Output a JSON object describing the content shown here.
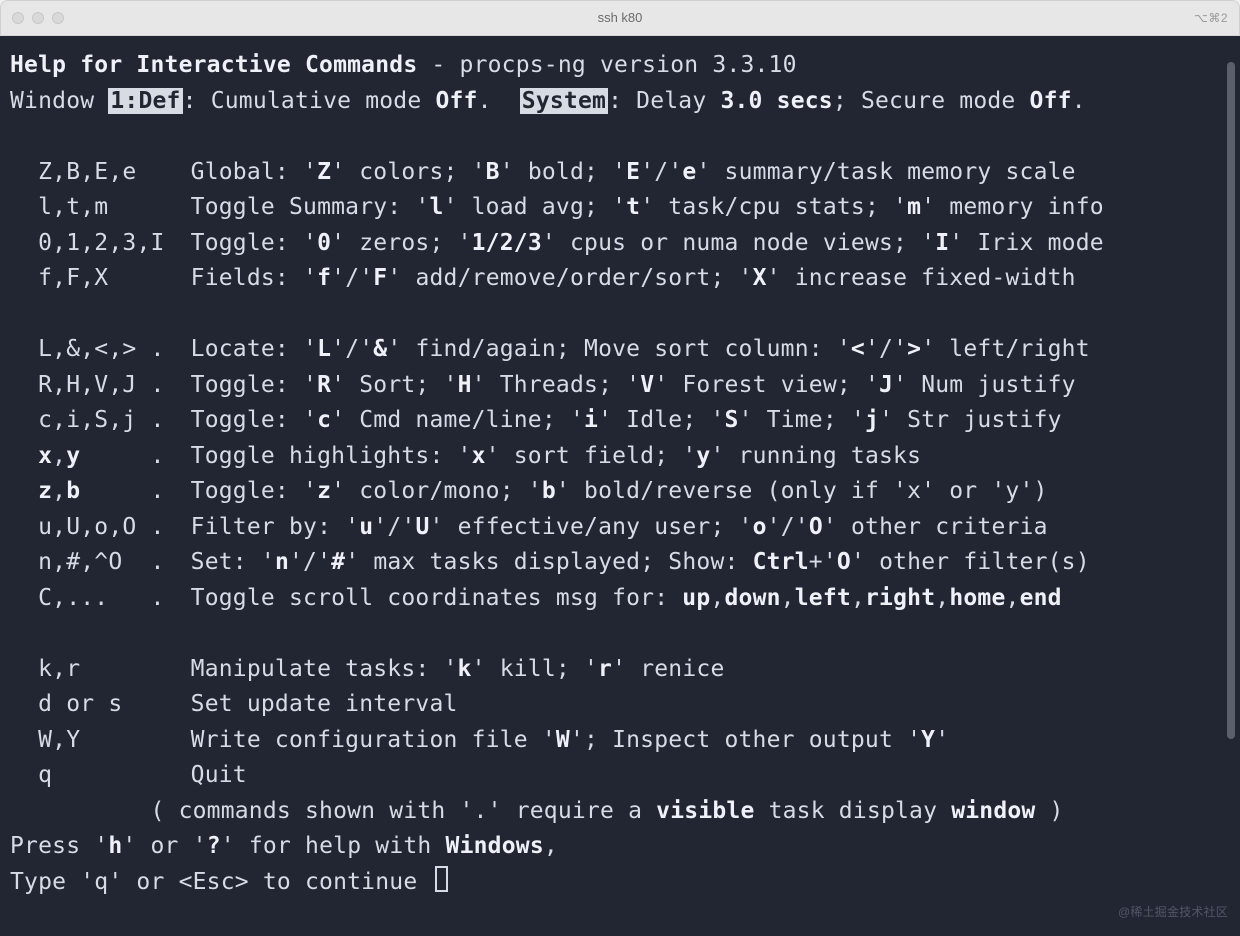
{
  "titlebar": {
    "title": "ssh k80",
    "indicator": "⌥⌘2"
  },
  "hdr": {
    "title_bold": "Help for Interactive Commands",
    "title_rest": " - procps-ng version 3.3.10",
    "win_label": "Window ",
    "win_tag": "1:Def",
    "win_mid": ": Cumulative mode ",
    "off1": "Off",
    "dotspace": ".  ",
    "sys": "System",
    "sys_rest": ": Delay ",
    "delay": "3.0",
    "secs": " secs",
    "secure": "; Secure mode ",
    "off2": "Off",
    "tail": "."
  },
  "help": [
    {
      "blank": true
    },
    {
      "k": "Z,B,E,e",
      "pre": "Global: '",
      "b1": "Z",
      "t1": "' colors; '",
      "b2": "B",
      "t2": "' bold; '",
      "b3": "E",
      "t3": "'/'",
      "b4": "e",
      "t4": "' summary/task memory scale"
    },
    {
      "k": "l,t,m",
      "pre": "Toggle Summary: '",
      "b1": "l",
      "t1": "' load avg; '",
      "b2": "t",
      "t2": "' task/cpu stats; '",
      "b3": "m",
      "t3": "' memory info"
    },
    {
      "k": "0,1,2,3,I",
      "pre": "Toggle: '",
      "b1": "0",
      "t1": "' zeros; '",
      "b2": "1/2/3",
      "t2": "' cpus or numa node views; '",
      "b3": "I",
      "t3": "' Irix mode"
    },
    {
      "k": "f,F,X",
      "pre": "Fields: '",
      "b1": "f",
      "t1": "'/'",
      "b2": "F",
      "t2": "' add/remove/order/sort; '",
      "b3": "X",
      "t3": "' increase fixed-width"
    },
    {
      "blank": true
    },
    {
      "k": "L,&,<,> .",
      "pre": "Locate: '",
      "b1": "L",
      "t1": "'/'",
      "b2": "&",
      "t2": "' find/again; Move sort column: '",
      "b3": "<",
      "t3": "'/'",
      "b4": ">",
      "t4": "' left/right"
    },
    {
      "k": "R,H,V,J .",
      "pre": "Toggle: '",
      "b1": "R",
      "t1": "' Sort; '",
      "b2": "H",
      "t2": "' Threads; '",
      "b3": "V",
      "t3": "' Forest view; '",
      "b4": "J",
      "t4": "' Num justify"
    },
    {
      "k": "c,i,S,j .",
      "pre": "Toggle: '",
      "b1": "c",
      "t1": "' Cmd name/line; '",
      "b2": "i",
      "t2": "' Idle; '",
      "b3": "S",
      "t3": "' Time; '",
      "b4": "j",
      "t4": "' Str justify"
    },
    {
      "k": "x,y     .",
      "kb": "x",
      "kc": ",",
      "kb2": "y",
      "krest": "     .",
      "pre": "Toggle highlights: '",
      "b1": "x",
      "t1": "' sort field; '",
      "b2": "y",
      "t2": "' running tasks"
    },
    {
      "k": "z,b     .",
      "kb": "z",
      "kc": ",",
      "kb2": "b",
      "krest": "     .",
      "pre": "Toggle: '",
      "b1": "z",
      "t1": "' color/mono; '",
      "b2": "b",
      "t2": "' bold/reverse (only if 'x' or 'y')"
    },
    {
      "k": "u,U,o,O .",
      "pre": "Filter by: '",
      "b1": "u",
      "t1": "'/'",
      "b2": "U",
      "t2": "' effective/any user; '",
      "b3": "o",
      "t3": "'/'",
      "b4": "O",
      "t4": "' other criteria"
    },
    {
      "k": "n,#,^O  .",
      "pre": "Set: '",
      "b1": "n",
      "t1": "'/'",
      "b2": "#",
      "t2": "' max tasks displayed; Show: ",
      "b3": "Ctrl",
      "t3": "+'",
      "b4": "O",
      "t4": "' other filter(s)"
    },
    {
      "k": "C,...   .",
      "pre": "Toggle scroll coordinates msg for: ",
      "b1": "up",
      "t1": ",",
      "b2": "down",
      "t2": ",",
      "b3": "left",
      "t3": ",",
      "b4": "right",
      "t4": ",",
      "b5": "home",
      "t5": ",",
      "b6": "end"
    },
    {
      "blank": true
    },
    {
      "k": "k,r",
      "pre": "Manipulate tasks: '",
      "b1": "k",
      "t1": "' kill; '",
      "b2": "r",
      "t2": "' renice"
    },
    {
      "k": "d or s",
      "plain": "Set update interval"
    },
    {
      "k": "W,Y",
      "pre": "Write configuration file '",
      "b1": "W",
      "t1": "'; Inspect other output '",
      "b2": "Y",
      "t2": "'"
    },
    {
      "k": "q",
      "plain": "Quit"
    }
  ],
  "footer": {
    "note_pre": "          ( commands shown with '.' require a ",
    "note_b1": "visible",
    "note_mid": " task display ",
    "note_b2": "window",
    "note_end": " )",
    "line1a": "Press '",
    "line1b": "h",
    "line1c": "' or '",
    "line1d": "?",
    "line1e": "' for help with ",
    "line1f": "Windows",
    "line1g": ",",
    "line2": "Type 'q' or <Esc> to continue "
  },
  "watermark": "@稀土掘金技术社区"
}
